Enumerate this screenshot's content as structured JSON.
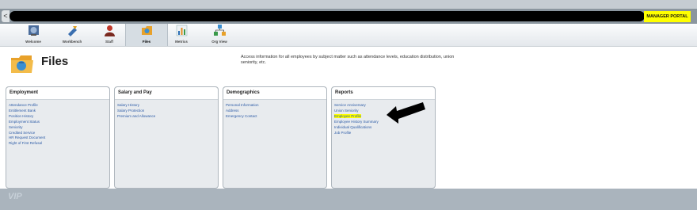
{
  "topbar": {
    "left_tab": "<",
    "portal_label": "MANAGER PORTAL",
    "portal_color": "#ffff00"
  },
  "nav": [
    {
      "label": "Welcome",
      "icon": "globe-icon"
    },
    {
      "label": "Workbench",
      "icon": "tools-icon"
    },
    {
      "label": "Staff",
      "icon": "person-icon"
    },
    {
      "label": "Files",
      "icon": "folder-icon",
      "active": true
    },
    {
      "label": "Metrics",
      "icon": "chart-icon"
    },
    {
      "label": "Org View",
      "icon": "org-chart-icon"
    }
  ],
  "page": {
    "title": "Files",
    "description": "Access information for all employees by subject matter such as attendance levels, education distribution, union seniority, etc."
  },
  "panels": [
    {
      "title": "Employment",
      "links": [
        "Attendance Profile",
        "Entitlement Bank",
        "Position History",
        "Employment Status",
        "Seniority",
        "Credited Service",
        "HR Request Document",
        "Right of First Refusal"
      ]
    },
    {
      "title": "Salary and Pay",
      "links": [
        "Salary History",
        "Salary Protection",
        "Premium and Allowance"
      ]
    },
    {
      "title": "Demographics",
      "links": [
        "Personal Information",
        "Address",
        "Emergency Contact"
      ]
    },
    {
      "title": "Reports",
      "links": [
        "Service Anniversary",
        "Union Seniority",
        "Employee Profile",
        "Employee History Summary",
        "Individual Qualifications",
        "Job Profile"
      ],
      "highlighted": "Employee Profile"
    }
  ],
  "footer": {
    "logo": "VIP"
  }
}
